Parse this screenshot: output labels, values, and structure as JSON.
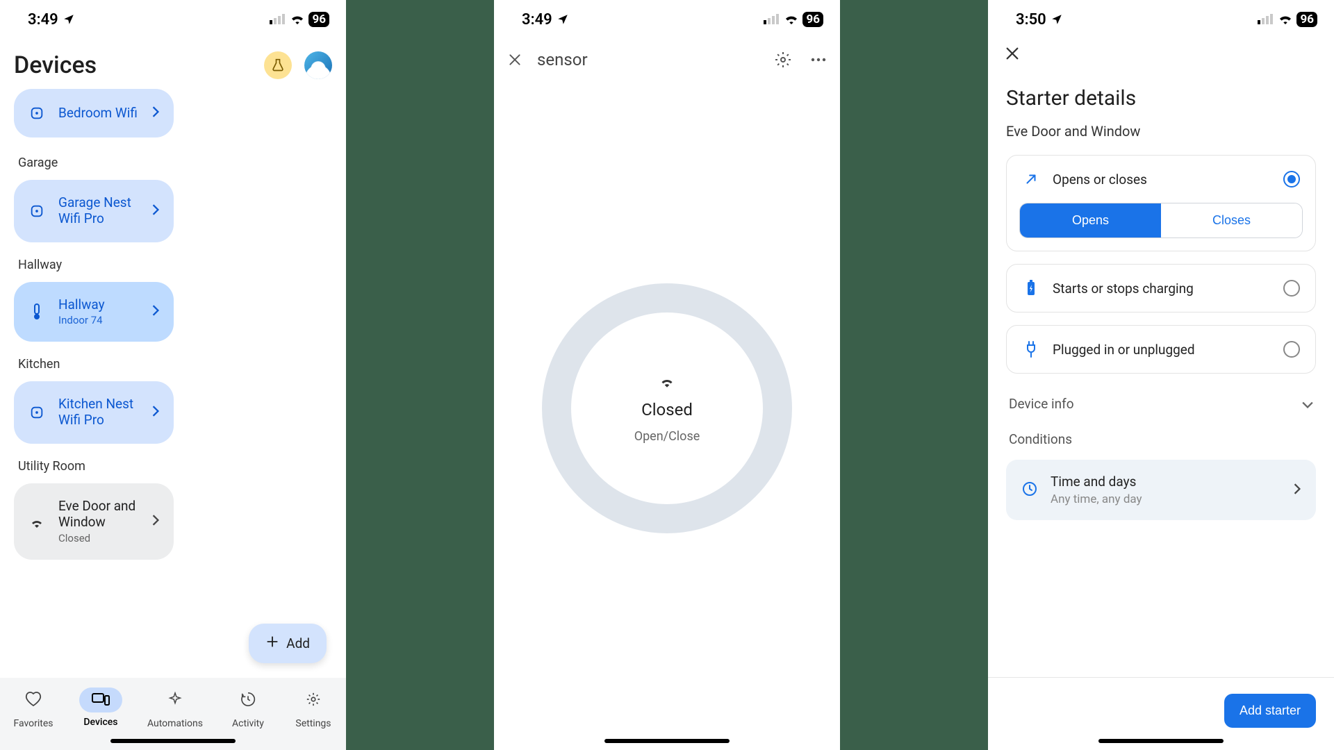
{
  "status": {
    "time_a": "3:49",
    "time_b": "3:50",
    "battery": "96"
  },
  "screen1": {
    "title": "Devices",
    "top_card": {
      "name": "Bedroom Wifi"
    },
    "sections": [
      {
        "label": "Garage",
        "card": {
          "name": "Garage Nest Wifi Pro"
        }
      },
      {
        "label": "Hallway",
        "card": {
          "name": "Hallway",
          "sub": "Indoor 74"
        }
      },
      {
        "label": "Kitchen",
        "card": {
          "name": "Kitchen Nest Wifi Pro"
        }
      },
      {
        "label": "Utility Room",
        "card": {
          "name": "Eve Door and Window",
          "sub": "Closed",
          "grey": true
        }
      }
    ],
    "add_label": "Add",
    "nav": [
      "Favorites",
      "Devices",
      "Automations",
      "Activity",
      "Settings"
    ]
  },
  "screen2": {
    "title": "sensor",
    "state": "Closed",
    "type": "Open/Close"
  },
  "screen3": {
    "title": "Starter details",
    "device": "Eve Door and Window",
    "options": [
      {
        "label": "Opens or closes",
        "selected": true,
        "seg": [
          "Opens",
          "Closes"
        ],
        "active_seg": 0
      },
      {
        "label": "Starts or stops charging",
        "selected": false
      },
      {
        "label": "Plugged in or unplugged",
        "selected": false
      }
    ],
    "device_info_label": "Device info",
    "conditions_label": "Conditions",
    "condition": {
      "title": "Time and days",
      "sub": "Any time, any day"
    },
    "cta": "Add starter"
  }
}
